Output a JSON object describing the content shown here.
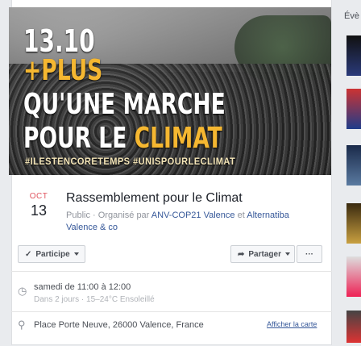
{
  "cover": {
    "line1": "13.10",
    "line2": "+PLUS",
    "line3": "QU'UNE MARCHE",
    "line4_a": "POUR LE ",
    "line4_b": "CLIMAT",
    "tags": "#ILESTENCORETEMPS #UNISPOURLECLIMAT"
  },
  "event": {
    "month": "OCT",
    "day": "13",
    "title": "Rassemblement pour le Climat",
    "privacy": "Public",
    "organized_by": "Organisé par",
    "org1": "ANV-COP21 Valence",
    "and": "et",
    "org2": "Alternatiba Valence & co"
  },
  "actions": {
    "participate": "Participe",
    "share": "Partager",
    "more": "···"
  },
  "details": {
    "when": "samedi de 11:00 à 12:00",
    "when_sub": "Dans 2 jours · 15–24°C Ensoleillé",
    "where": "Place Porte Neuve, 26000 Valence, France",
    "map_link": "Afficher la carte"
  },
  "sidebar": {
    "heading": "Évè"
  },
  "colors": {
    "accent": "#f5b731",
    "link": "#365899",
    "month": "#e0545f"
  }
}
